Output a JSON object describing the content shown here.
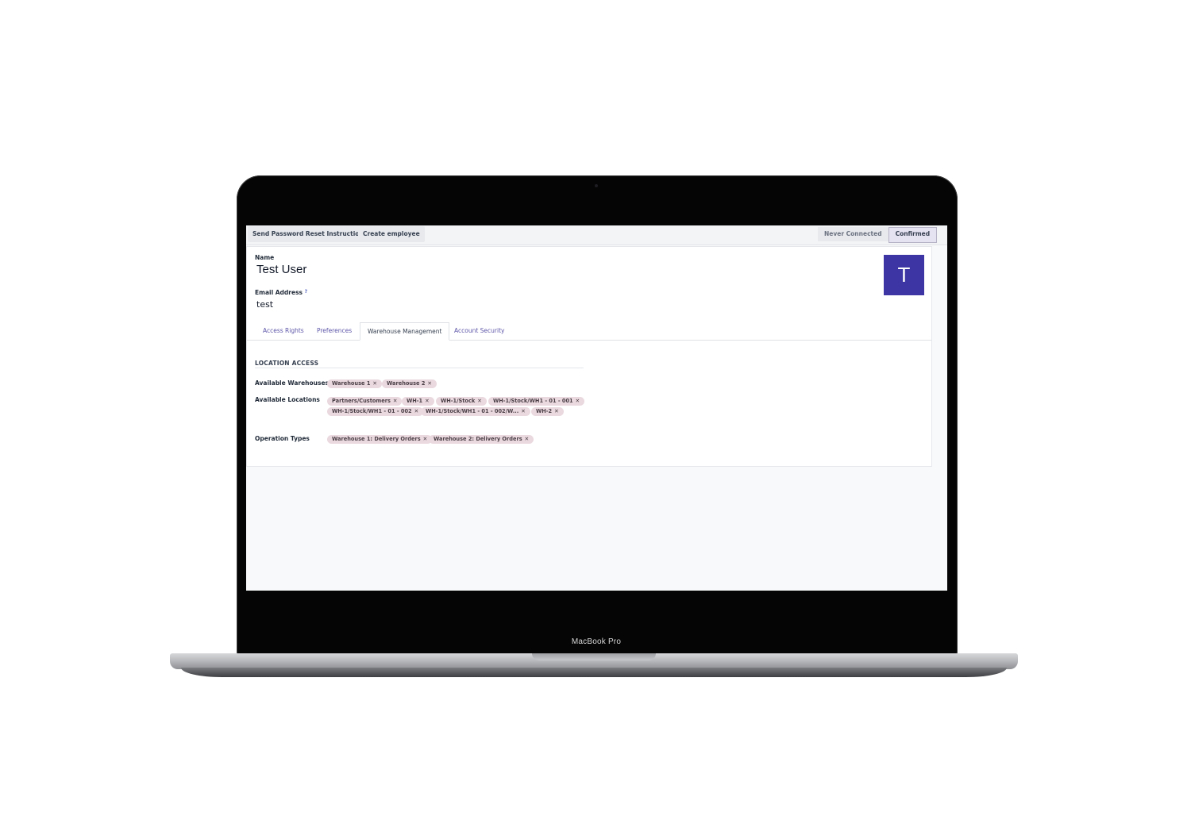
{
  "device": {
    "label": "MacBook Pro"
  },
  "toolbar": {
    "buttons": [
      "Send Password Reset Instructions",
      "Create employee"
    ],
    "statuses": [
      "Never Connected",
      "Confirmed"
    ],
    "active_status": "Confirmed"
  },
  "form": {
    "name_label": "Name",
    "name_value": "Test User",
    "email_label": "Email Address",
    "email_help": "?",
    "email_value": "test",
    "avatar_letter": "T",
    "avatar_color": "#3c35a3"
  },
  "tabs": [
    {
      "label": "Access Rights"
    },
    {
      "label": "Preferences"
    },
    {
      "label": "Warehouse Management",
      "active": true
    },
    {
      "label": "Account Security"
    }
  ],
  "section": {
    "title": "LOCATION ACCESS",
    "fields": [
      {
        "label": "Available Warehouses",
        "tags": [
          "Warehouse 1",
          "Warehouse 2"
        ]
      },
      {
        "label": "Available Locations",
        "tags": [
          "Partners/Customers",
          "WH-1",
          "WH-1/Stock",
          "WH-1/Stock/WH1 - 01 - 001",
          "WH-1/Stock/WH1 - 01 - 002",
          "WH-1/Stock/WH1 - 01 - 002/W...",
          "WH-2"
        ]
      },
      {
        "label": "Operation Types",
        "tags": [
          "Warehouse 1: Delivery Orders",
          "Warehouse 2: Delivery Orders"
        ]
      }
    ]
  },
  "tag_remove_glyph": "✕"
}
